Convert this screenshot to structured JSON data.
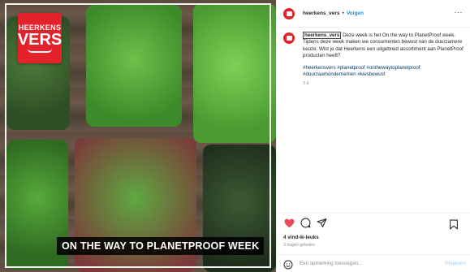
{
  "media": {
    "logo_line1": "HEERKENS",
    "logo_line2": "VERS",
    "banner_text": "ON THE WAY TO PLANETPROOF WEEK"
  },
  "header": {
    "username": "heerkens_vers",
    "separator": "•",
    "follow_label": "Volgen",
    "more_label": "···"
  },
  "caption": {
    "username": "heerkens_vers",
    "text": " Deze week is het On the way to PlanetProof week. Tijdens deze week maken we consumenten bewust van de duurzamere keuze. Wist je dat Heerkens een uitgebreid assortiment aan PlanetProof producten heeft?",
    "hashtags": "#heerkensvers #planetproof #onthewaytoplanetproof #duurzaamondernemen #kiesbewust",
    "time": "3 d"
  },
  "actions": {
    "icons": [
      "heart-icon",
      "comment-icon",
      "share-icon",
      "bookmark-icon"
    ],
    "like_color": "#ed4956"
  },
  "likes": "4 vind-ik-leuks",
  "posted_ago": "3 dagen geleden",
  "comment_box": {
    "placeholder": "Een opmerking toevoegen...",
    "post_label": "Plaatsen"
  },
  "colors": {
    "brand_red": "#e3222b",
    "link_blue": "#0095f6",
    "hashtag_blue": "#00376b"
  }
}
